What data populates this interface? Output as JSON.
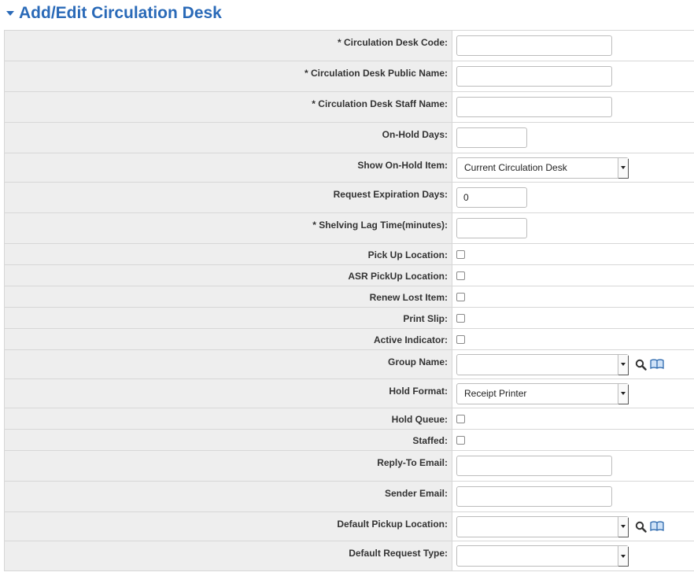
{
  "header": {
    "title": "Add/Edit Circulation Desk"
  },
  "fields": {
    "desk_code": {
      "label": "* Circulation Desk Code:",
      "value": ""
    },
    "public_name": {
      "label": "* Circulation Desk Public Name:",
      "value": ""
    },
    "staff_name": {
      "label": "* Circulation Desk Staff Name:",
      "value": ""
    },
    "on_hold_days": {
      "label": "On-Hold Days:",
      "value": ""
    },
    "show_on_hold_item": {
      "label": "Show On-Hold Item:",
      "value": "Current Circulation Desk"
    },
    "request_expiration_days": {
      "label": "Request Expiration Days:",
      "value": "0"
    },
    "shelving_lag_time": {
      "label": "* Shelving Lag Time(minutes):",
      "value": ""
    },
    "pick_up_location": {
      "label": "Pick Up Location:",
      "checked": false
    },
    "asr_pickup_location": {
      "label": "ASR PickUp Location:",
      "checked": false
    },
    "renew_lost_item": {
      "label": "Renew Lost Item:",
      "checked": false
    },
    "print_slip": {
      "label": "Print Slip:",
      "checked": false
    },
    "active_indicator": {
      "label": "Active Indicator:",
      "checked": false
    },
    "group_name": {
      "label": "Group Name:",
      "value": ""
    },
    "hold_format": {
      "label": "Hold Format:",
      "value": "Receipt Printer"
    },
    "hold_queue": {
      "label": "Hold Queue:",
      "checked": false
    },
    "staffed": {
      "label": "Staffed:",
      "checked": false
    },
    "reply_to_email": {
      "label": "Reply-To Email:",
      "value": ""
    },
    "sender_email": {
      "label": "Sender Email:",
      "value": ""
    },
    "default_pickup_location": {
      "label": "Default Pickup Location:",
      "value": ""
    },
    "default_request_type": {
      "label": "Default Request Type:",
      "value": ""
    }
  },
  "icons": {
    "lookup": "magnifier-icon",
    "browse": "book-icon"
  },
  "colors": {
    "title": "#2a6ab8",
    "label_bg": "#eeeeee",
    "border": "#d7d7d7",
    "book_icon": "#1f5fa8"
  }
}
